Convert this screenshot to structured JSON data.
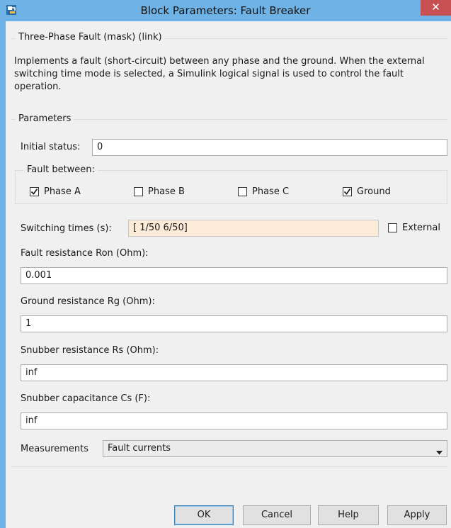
{
  "window": {
    "title": "Block Parameters: Fault Breaker",
    "close_glyph": "✕"
  },
  "mask": {
    "legend": "Three-Phase Fault (mask) (link)",
    "description": "Implements a fault (short-circuit) between any phase and the ground. When the external switching time mode is selected, a Simulink logical signal is used to control the fault operation."
  },
  "parameters": {
    "legend": "Parameters",
    "initial_status_label": "Initial status:",
    "initial_status_value": "0",
    "fault_between_legend": "Fault between:",
    "phases": [
      {
        "label": "Phase A",
        "checked": true
      },
      {
        "label": "Phase B",
        "checked": false
      },
      {
        "label": "Phase C",
        "checked": false
      },
      {
        "label": "Ground",
        "checked": true
      }
    ],
    "switching_times_label": "Switching times (s):",
    "switching_times_value": "[ 1/50 6/50]",
    "external_label": "External",
    "external_checked": false,
    "fault_resistance_label": "Fault resistance Ron (Ohm):",
    "fault_resistance_value": "0.001",
    "ground_resistance_label": "Ground resistance Rg (Ohm):",
    "ground_resistance_value": "1",
    "snubber_resistance_label": "Snubber resistance Rs (Ohm):",
    "snubber_resistance_value": "inf",
    "snubber_capacitance_label": "Snubber capacitance Cs (F):",
    "snubber_capacitance_value": "inf",
    "measurements_label": "Measurements",
    "measurements_value": "Fault currents"
  },
  "buttons": {
    "ok": "OK",
    "cancel": "Cancel",
    "help": "Help",
    "apply": "Apply"
  },
  "colors": {
    "frame": "#6fb2e6",
    "close": "#c75050",
    "highlight_field": "#fdebd9"
  }
}
